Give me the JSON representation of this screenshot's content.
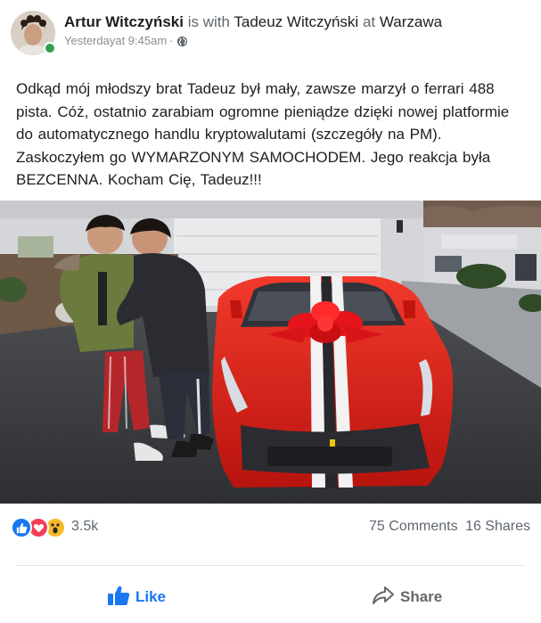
{
  "post": {
    "author": "Artur Witczyński",
    "with_text": "is with",
    "tagged": "Tadeuz Witczyński",
    "at_text": "at",
    "location": "Warzawa",
    "timestamp": "Yesterdayat 9:45am",
    "separator": "·",
    "privacy_icon": "globe-icon",
    "text_lines": [
      "Odkąd mój młodszy brat Tadeuz był mały, zawsze marzył o ferrari 488",
      "pista. Cóż, ostatnio zarabiam ogromne pieniądze dzięki nowej platformie",
      "do automatycznego handlu kryptowalutami (szczegóły na PM).",
      "Zaskoczyłem go WYMARZONYM SAMOCHODEM. Jego reakcja była",
      "BEZCENNA. Kocham Cię, Tadeuz!!!"
    ]
  },
  "reactions": {
    "icons": [
      "like-icon",
      "love-icon",
      "wow-icon"
    ],
    "count": "3.5k",
    "comments": "75 Comments",
    "shares": "16 Shares"
  },
  "actions": {
    "like_label": "Like",
    "share_label": "Share"
  },
  "colors": {
    "accent": "#1877f2",
    "online": "#31a24c",
    "love": "#f33e58",
    "wow": "#f7b928",
    "car_red": "#e5201c"
  }
}
